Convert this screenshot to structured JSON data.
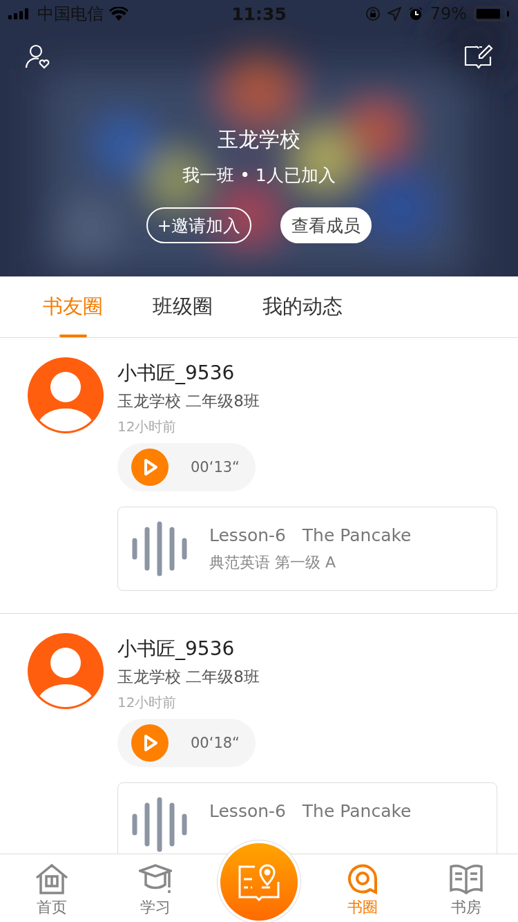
{
  "status_bar": {
    "carrier": "中国电信",
    "time": "11:35",
    "battery": "79%"
  },
  "header": {
    "school": "玉龙学校",
    "class_info": "我一班 • 1人已加入",
    "buttons": [
      {
        "label": "+邀请加入",
        "kind": "outline"
      },
      {
        "label": "查看成员",
        "kind": "filled"
      }
    ]
  },
  "tabs": [
    {
      "label": "书友圈",
      "selected": true
    },
    {
      "label": "班级圈",
      "selected": false
    },
    {
      "label": "我的动态",
      "selected": false
    }
  ],
  "posts": [
    {
      "user": "小书匠_9536",
      "school": "玉龙学校 二年级8班",
      "time": "12小时前",
      "duration": "00‘13“",
      "lesson_title": "Lesson-6   The Pancake",
      "lesson_subtitle": "典范英语 第一级 A"
    },
    {
      "user": "小书匠_9536",
      "school": "玉龙学校 二年级8班",
      "time": "12小时前",
      "duration": "00‘18“",
      "lesson_title": "Lesson-6   The Pancake"
    }
  ],
  "tab_bar": [
    {
      "label": "首页",
      "kind": "home",
      "selected": false
    },
    {
      "label": "学习",
      "kind": "study",
      "selected": false
    },
    {
      "kind": "center",
      "selected": false
    },
    {
      "label": "书圈",
      "kind": "circle",
      "selected": true
    },
    {
      "label": "书房",
      "kind": "library",
      "selected": false
    }
  ]
}
